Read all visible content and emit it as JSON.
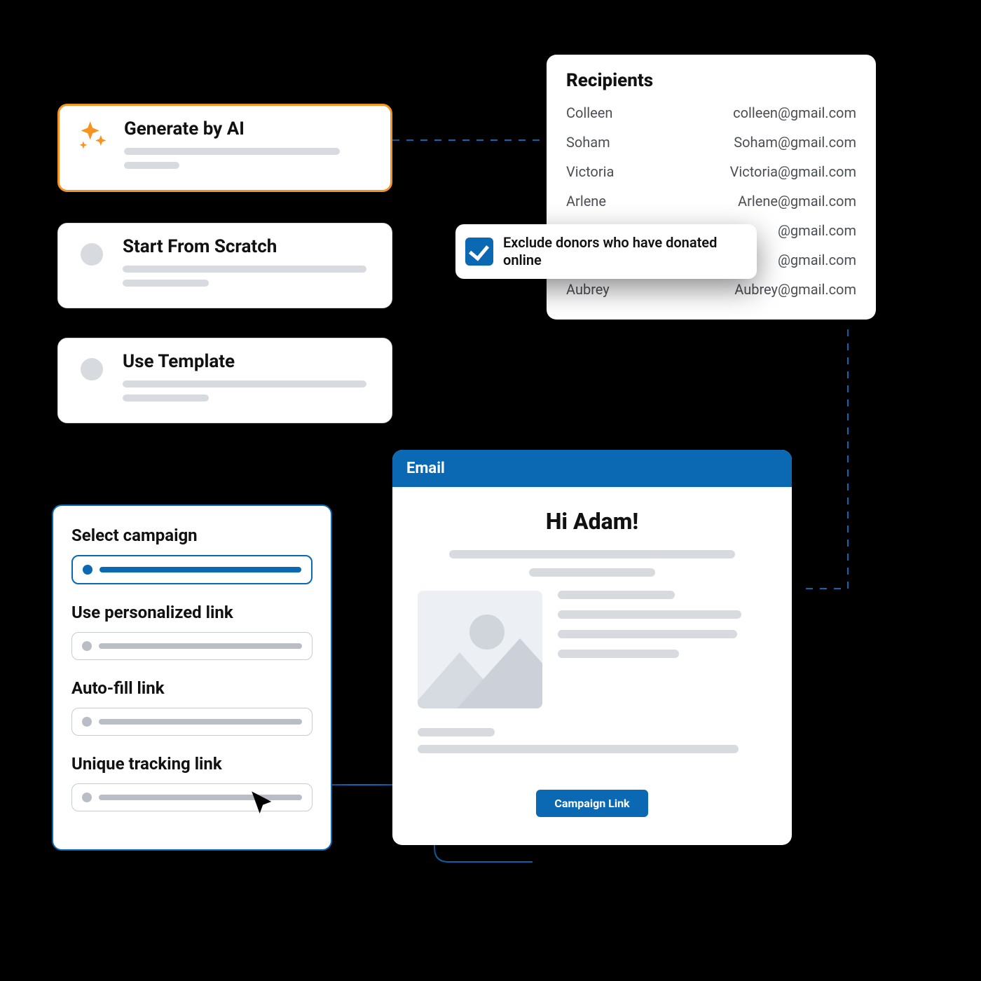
{
  "options": {
    "ai": {
      "title": "Generate by AI"
    },
    "scratch": {
      "title": "Start From Scratch"
    },
    "template": {
      "title": "Use Template"
    }
  },
  "recipients": {
    "title": "Recipients",
    "rows": [
      {
        "name": "Colleen",
        "email": "colleen@gmail.com"
      },
      {
        "name": "Soham",
        "email": "Soham@gmail.com"
      },
      {
        "name": "Victoria",
        "email": "Victoria@gmail.com"
      },
      {
        "name": "Arlene",
        "email": "Arlene@gmail.com"
      },
      {
        "name": "",
        "email": "@gmail.com"
      },
      {
        "name": "",
        "email": "@gmail.com"
      },
      {
        "name": "Aubrey",
        "email": "Aubrey@gmail.com"
      }
    ],
    "exclude_label": "Exclude donors who have donated online",
    "exclude_checked": true
  },
  "campaign": {
    "fields": [
      {
        "label": "Select campaign",
        "active": true
      },
      {
        "label": "Use personalized link",
        "active": false
      },
      {
        "label": "Auto-fill link",
        "active": false
      },
      {
        "label": "Unique tracking link",
        "active": false
      }
    ]
  },
  "email": {
    "header": "Email",
    "greeting": "Hi Adam!",
    "cta": "Campaign Link"
  },
  "colors": {
    "accent": "#0b68b3",
    "highlight": "#f7941e"
  }
}
